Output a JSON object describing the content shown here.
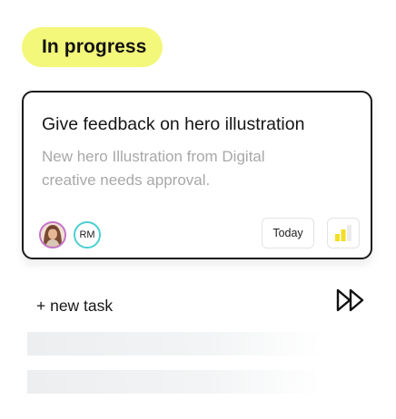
{
  "status": {
    "label": "In progress",
    "color": "#f3f77a"
  },
  "card": {
    "title": "Give feedback on hero illustration",
    "description": "New hero Illustration from Digital creative needs approval.",
    "assignees": [
      {
        "type": "photo",
        "icon": "user-photo-avatar",
        "ring_color": "#c471c7"
      },
      {
        "type": "initials",
        "initials": "RM",
        "ring_color": "#4ecfd2"
      }
    ],
    "due": "Today",
    "priority": {
      "icon": "priority-bars-icon",
      "level": "medium",
      "active_color": "#f3de23"
    }
  },
  "actions": {
    "new_task_label": "+ new task",
    "forward_icon": "fast-forward-icon"
  },
  "placeholders": {
    "skeleton_count": 2
  }
}
